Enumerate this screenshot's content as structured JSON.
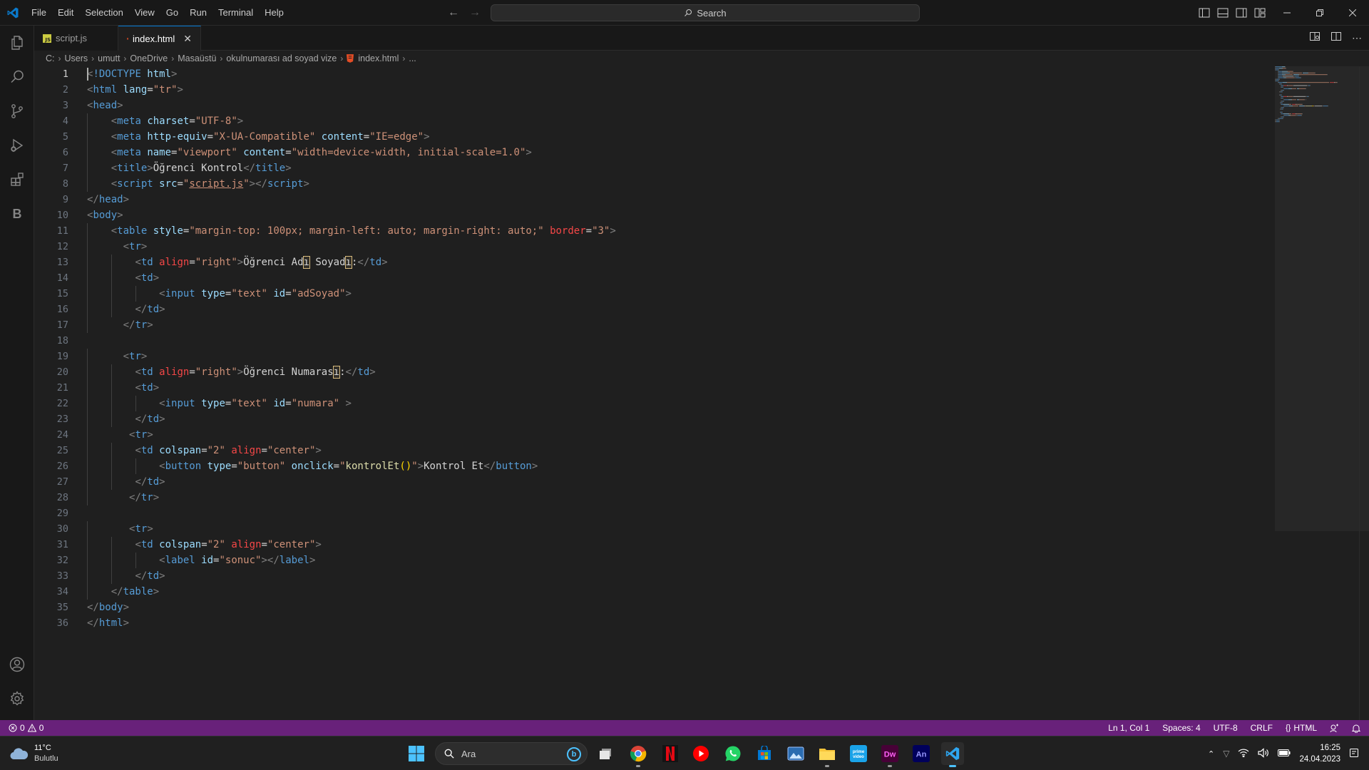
{
  "titlebar": {
    "menu": [
      "File",
      "Edit",
      "Selection",
      "View",
      "Go",
      "Run",
      "Terminal",
      "Help"
    ],
    "search_label": "Search"
  },
  "tabs": [
    {
      "label": "script.js",
      "icon": "js-file-icon",
      "active": false
    },
    {
      "label": "index.html",
      "icon": "html-file-icon",
      "active": true
    }
  ],
  "breadcrumb": [
    "C:",
    "Users",
    "umutt",
    "OneDrive",
    "Masaüstü",
    "okulnumarası ad soyad vize",
    "index.html",
    "..."
  ],
  "editor": {
    "current_line": 1,
    "line_numbers": [
      "1",
      "2",
      "3",
      "4",
      "5",
      "6",
      "7",
      "8",
      "9",
      "10",
      "11",
      "12",
      "13",
      "14",
      "15",
      "16",
      "17",
      "18",
      "19",
      "20",
      "21",
      "22",
      "23",
      "24",
      "25",
      "26",
      "27",
      "28",
      "29",
      "30",
      "31",
      "32",
      "33",
      "34",
      "35",
      "36"
    ],
    "lines": [
      [
        [
          "pun",
          "<"
        ],
        [
          "tag",
          "!DOCTYPE "
        ],
        [
          "attr-plain",
          "html"
        ],
        [
          "pun",
          ">"
        ]
      ],
      [
        [
          "pun",
          "<"
        ],
        [
          "tag",
          "html "
        ],
        [
          "attr",
          "lang"
        ],
        [
          "text",
          "="
        ],
        [
          "str",
          "\"tr\""
        ],
        [
          "pun",
          ">"
        ]
      ],
      [
        [
          "pun",
          "<"
        ],
        [
          "tag",
          "head"
        ],
        [
          "pun",
          ">"
        ]
      ],
      [
        [
          "ws",
          "    "
        ],
        [
          "pun",
          "<"
        ],
        [
          "tag",
          "meta "
        ],
        [
          "attr",
          "charset"
        ],
        [
          "text",
          "="
        ],
        [
          "str",
          "\"UTF-8\""
        ],
        [
          "pun",
          ">"
        ]
      ],
      [
        [
          "ws",
          "    "
        ],
        [
          "pun",
          "<"
        ],
        [
          "tag",
          "meta "
        ],
        [
          "attr",
          "http-equiv"
        ],
        [
          "text",
          "="
        ],
        [
          "str",
          "\"X-UA-Compatible\""
        ],
        [
          "text",
          " "
        ],
        [
          "attr",
          "content"
        ],
        [
          "text",
          "="
        ],
        [
          "str",
          "\"IE=edge\""
        ],
        [
          "pun",
          ">"
        ]
      ],
      [
        [
          "ws",
          "    "
        ],
        [
          "pun",
          "<"
        ],
        [
          "tag",
          "meta "
        ],
        [
          "attr",
          "name"
        ],
        [
          "text",
          "="
        ],
        [
          "str",
          "\"viewport\""
        ],
        [
          "text",
          " "
        ],
        [
          "attr",
          "content"
        ],
        [
          "text",
          "="
        ],
        [
          "str",
          "\"width=device-width, initial-scale=1.0\""
        ],
        [
          "pun",
          ">"
        ]
      ],
      [
        [
          "ws",
          "    "
        ],
        [
          "pun",
          "<"
        ],
        [
          "tag",
          "title"
        ],
        [
          "pun",
          ">"
        ],
        [
          "text",
          "Öğrenci Kontrol"
        ],
        [
          "pun",
          "</"
        ],
        [
          "tag",
          "title"
        ],
        [
          "pun",
          ">"
        ]
      ],
      [
        [
          "ws",
          "    "
        ],
        [
          "pun",
          "<"
        ],
        [
          "tag",
          "script "
        ],
        [
          "attr",
          "src"
        ],
        [
          "text",
          "="
        ],
        [
          "str",
          "\""
        ],
        [
          "link",
          "script.js"
        ],
        [
          "str",
          "\""
        ],
        [
          "pun",
          "></"
        ],
        [
          "tag",
          "script"
        ],
        [
          "pun",
          ">"
        ]
      ],
      [
        [
          "pun",
          "</"
        ],
        [
          "tag",
          "head"
        ],
        [
          "pun",
          ">"
        ]
      ],
      [
        [
          "pun",
          "<"
        ],
        [
          "tag",
          "body"
        ],
        [
          "pun",
          ">"
        ]
      ],
      [
        [
          "ws",
          "    "
        ],
        [
          "pun",
          "<"
        ],
        [
          "tag",
          "table "
        ],
        [
          "attr",
          "style"
        ],
        [
          "text",
          "="
        ],
        [
          "str",
          "\"margin-top: 100px; margin-left: auto; margin-right: auto;\""
        ],
        [
          "text",
          " "
        ],
        [
          "attr-red",
          "border"
        ],
        [
          "text",
          "="
        ],
        [
          "str",
          "\"3\""
        ],
        [
          "pun",
          ">"
        ]
      ],
      [
        [
          "ws",
          "      "
        ],
        [
          "pun",
          "<"
        ],
        [
          "tag",
          "tr"
        ],
        [
          "pun",
          ">"
        ]
      ],
      [
        [
          "ws",
          "        "
        ],
        [
          "pun",
          "<"
        ],
        [
          "tag",
          "td "
        ],
        [
          "attr-red",
          "align"
        ],
        [
          "text",
          "="
        ],
        [
          "str",
          "\"right\""
        ],
        [
          "pun",
          ">"
        ],
        [
          "text",
          "Öğrenci Ad"
        ],
        [
          "warn",
          "ı"
        ],
        [
          "text",
          " Soyad"
        ],
        [
          "warn",
          "ı"
        ],
        [
          "text",
          ":"
        ],
        [
          "pun",
          "</"
        ],
        [
          "tag",
          "td"
        ],
        [
          "pun",
          ">"
        ]
      ],
      [
        [
          "ws",
          "        "
        ],
        [
          "pun",
          "<"
        ],
        [
          "tag",
          "td"
        ],
        [
          "pun",
          ">"
        ]
      ],
      [
        [
          "ws",
          "            "
        ],
        [
          "pun",
          "<"
        ],
        [
          "tag",
          "input "
        ],
        [
          "attr",
          "type"
        ],
        [
          "text",
          "="
        ],
        [
          "str",
          "\"text\""
        ],
        [
          "text",
          " "
        ],
        [
          "attr",
          "id"
        ],
        [
          "text",
          "="
        ],
        [
          "str",
          "\"adSoyad\""
        ],
        [
          "pun",
          ">"
        ]
      ],
      [
        [
          "ws",
          "        "
        ],
        [
          "pun",
          "</"
        ],
        [
          "tag",
          "td"
        ],
        [
          "pun",
          ">"
        ]
      ],
      [
        [
          "ws",
          "      "
        ],
        [
          "pun",
          "</"
        ],
        [
          "tag",
          "tr"
        ],
        [
          "pun",
          ">"
        ]
      ],
      [],
      [
        [
          "ws",
          "      "
        ],
        [
          "pun",
          "<"
        ],
        [
          "tag",
          "tr"
        ],
        [
          "pun",
          ">"
        ]
      ],
      [
        [
          "ws",
          "        "
        ],
        [
          "pun",
          "<"
        ],
        [
          "tag",
          "td "
        ],
        [
          "attr-red",
          "align"
        ],
        [
          "text",
          "="
        ],
        [
          "str",
          "\"right\""
        ],
        [
          "pun",
          ">"
        ],
        [
          "text",
          "Öğrenci Numaras"
        ],
        [
          "warn",
          "ı"
        ],
        [
          "text",
          ":"
        ],
        [
          "pun",
          "</"
        ],
        [
          "tag",
          "td"
        ],
        [
          "pun",
          ">"
        ]
      ],
      [
        [
          "ws",
          "        "
        ],
        [
          "pun",
          "<"
        ],
        [
          "tag",
          "td"
        ],
        [
          "pun",
          ">"
        ]
      ],
      [
        [
          "ws",
          "            "
        ],
        [
          "pun",
          "<"
        ],
        [
          "tag",
          "input "
        ],
        [
          "attr",
          "type"
        ],
        [
          "text",
          "="
        ],
        [
          "str",
          "\"text\""
        ],
        [
          "text",
          " "
        ],
        [
          "attr",
          "id"
        ],
        [
          "text",
          "="
        ],
        [
          "str",
          "\"numara\""
        ],
        [
          "text",
          " "
        ],
        [
          "pun",
          ">"
        ]
      ],
      [
        [
          "ws",
          "        "
        ],
        [
          "pun",
          "</"
        ],
        [
          "tag",
          "td"
        ],
        [
          "pun",
          ">"
        ]
      ],
      [
        [
          "ws",
          "       "
        ],
        [
          "pun",
          "<"
        ],
        [
          "tag",
          "tr"
        ],
        [
          "pun",
          ">"
        ]
      ],
      [
        [
          "ws",
          "        "
        ],
        [
          "pun",
          "<"
        ],
        [
          "tag",
          "td "
        ],
        [
          "attr",
          "colspan"
        ],
        [
          "text",
          "="
        ],
        [
          "str",
          "\"2\""
        ],
        [
          "text",
          " "
        ],
        [
          "attr-red",
          "align"
        ],
        [
          "text",
          "="
        ],
        [
          "str",
          "\"center\""
        ],
        [
          "pun",
          ">"
        ]
      ],
      [
        [
          "ws",
          "            "
        ],
        [
          "pun",
          "<"
        ],
        [
          "tag",
          "button "
        ],
        [
          "attr",
          "type"
        ],
        [
          "text",
          "="
        ],
        [
          "str",
          "\"button\""
        ],
        [
          "text",
          " "
        ],
        [
          "attr",
          "onclick"
        ],
        [
          "text",
          "="
        ],
        [
          "str",
          "\""
        ],
        [
          "fn",
          "kontrolEt"
        ],
        [
          "brace",
          "()"
        ],
        [
          "str",
          "\""
        ],
        [
          "pun",
          ">"
        ],
        [
          "text",
          "Kontrol Et"
        ],
        [
          "pun",
          "</"
        ],
        [
          "tag",
          "button"
        ],
        [
          "pun",
          ">"
        ]
      ],
      [
        [
          "ws",
          "        "
        ],
        [
          "pun",
          "</"
        ],
        [
          "tag",
          "td"
        ],
        [
          "pun",
          ">"
        ]
      ],
      [
        [
          "ws",
          "       "
        ],
        [
          "pun",
          "</"
        ],
        [
          "tag",
          "tr"
        ],
        [
          "pun",
          ">"
        ]
      ],
      [],
      [
        [
          "ws",
          "       "
        ],
        [
          "pun",
          "<"
        ],
        [
          "tag",
          "tr"
        ],
        [
          "pun",
          ">"
        ]
      ],
      [
        [
          "ws",
          "        "
        ],
        [
          "pun",
          "<"
        ],
        [
          "tag",
          "td "
        ],
        [
          "attr",
          "colspan"
        ],
        [
          "text",
          "="
        ],
        [
          "str",
          "\"2\""
        ],
        [
          "text",
          " "
        ],
        [
          "attr-red",
          "align"
        ],
        [
          "text",
          "="
        ],
        [
          "str",
          "\"center\""
        ],
        [
          "pun",
          ">"
        ]
      ],
      [
        [
          "ws",
          "            "
        ],
        [
          "pun",
          "<"
        ],
        [
          "tag",
          "label "
        ],
        [
          "attr",
          "id"
        ],
        [
          "text",
          "="
        ],
        [
          "str",
          "\"sonuc\""
        ],
        [
          "pun",
          "></"
        ],
        [
          "tag",
          "label"
        ],
        [
          "pun",
          ">"
        ]
      ],
      [
        [
          "ws",
          "        "
        ],
        [
          "pun",
          "</"
        ],
        [
          "tag",
          "td"
        ],
        [
          "pun",
          ">"
        ]
      ],
      [
        [
          "ws",
          "    "
        ],
        [
          "pun",
          "</"
        ],
        [
          "tag",
          "table"
        ],
        [
          "pun",
          ">"
        ]
      ],
      [
        [
          "pun",
          "</"
        ],
        [
          "tag",
          "body"
        ],
        [
          "pun",
          ">"
        ]
      ],
      [
        [
          "pun",
          "</"
        ],
        [
          "tag",
          "html"
        ],
        [
          "pun",
          ">"
        ]
      ]
    ]
  },
  "statusbar": {
    "errors": "0",
    "warnings": "0",
    "position": "Ln 1, Col 1",
    "spaces": "Spaces: 4",
    "encoding": "UTF-8",
    "eol": "CRLF",
    "language": "HTML",
    "accent_color": "#68217a"
  },
  "taskbar": {
    "weather_temp": "11°C",
    "weather_cond": "Bulutlu",
    "search_placeholder": "Ara",
    "time": "16:25",
    "date": "24.04.2023"
  }
}
